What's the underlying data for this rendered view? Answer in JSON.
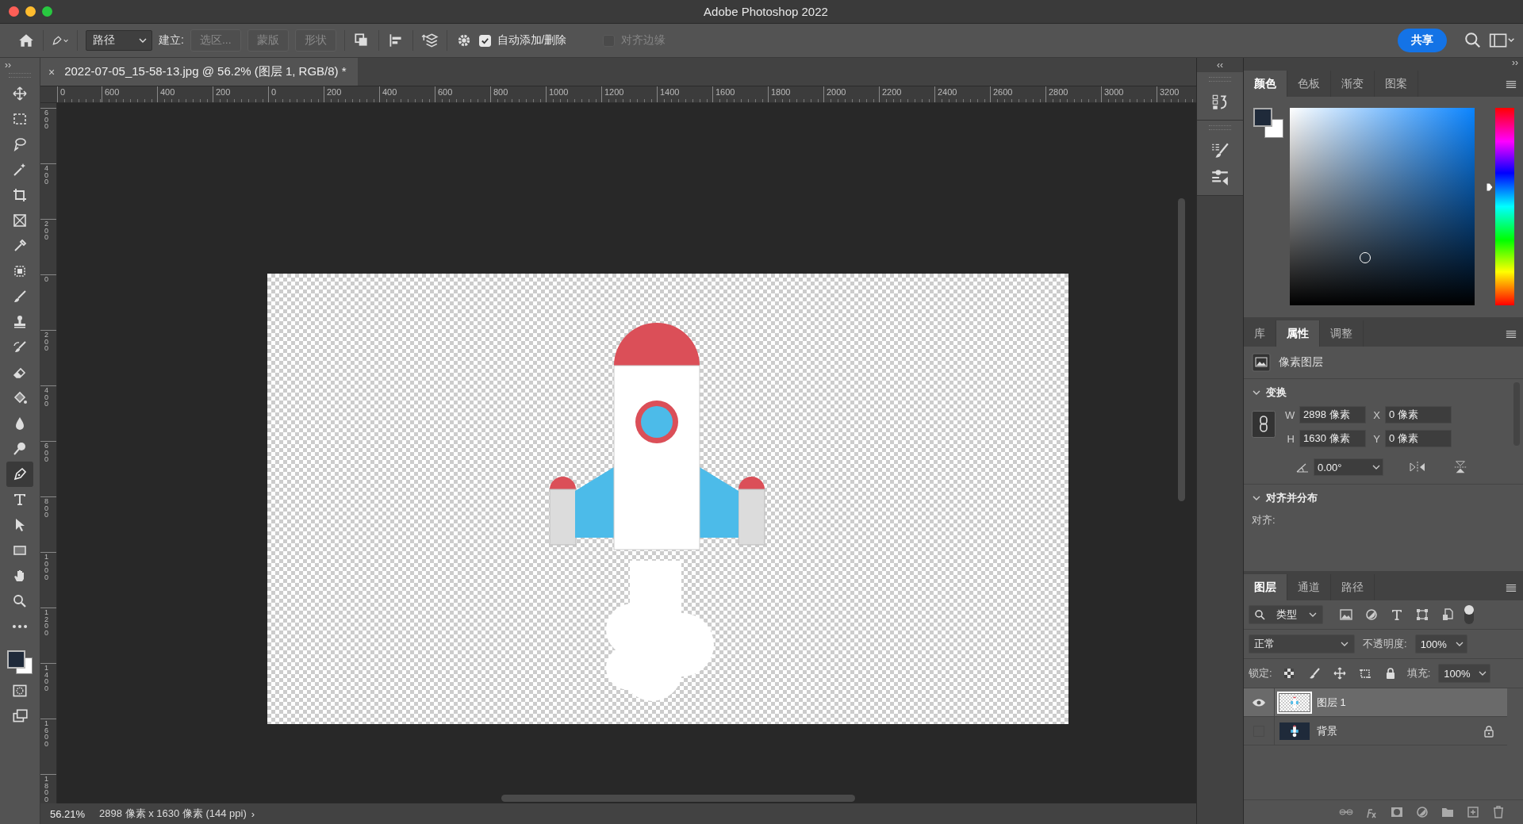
{
  "window": {
    "title": "Adobe Photoshop 2022"
  },
  "options_bar": {
    "mode": "路径",
    "make_label": "建立:",
    "make_buttons": [
      {
        "label": "选区...",
        "disabled": true
      },
      {
        "label": "蒙版",
        "disabled": true
      },
      {
        "label": "形状",
        "disabled": true
      }
    ],
    "auto_add_delete": {
      "label": "自动添加/删除",
      "checked": true
    },
    "align_edges": {
      "label": "对齐边缘",
      "checked": false,
      "disabled": true
    },
    "share_button": "共享"
  },
  "collapse_marks": {
    "toolbar": "››",
    "dock": "‹‹",
    "panels": "››"
  },
  "document_tab": {
    "close": "×",
    "title": "2022-07-05_15-58-13.jpg @ 56.2% (图层 1, RGB/8) *"
  },
  "ruler_h": [
    "0",
    "600",
    "400",
    "200",
    "0",
    "200",
    "400",
    "600",
    "800",
    "1000",
    "1200",
    "1400",
    "1600",
    "1800",
    "2000",
    "2200",
    "2400",
    "2600",
    "2800",
    "3000",
    "3200"
  ],
  "ruler_v": [
    "600",
    "400",
    "200",
    "0",
    "200",
    "400",
    "600",
    "800",
    "1000",
    "1200",
    "1400",
    "1600",
    "1800"
  ],
  "tools": [
    {
      "kind": "move",
      "selected": false
    },
    {
      "kind": "marquee",
      "selected": false
    },
    {
      "kind": "lasso",
      "selected": false
    },
    {
      "kind": "wand",
      "selected": false
    },
    {
      "kind": "crop",
      "selected": false
    },
    {
      "kind": "frame",
      "selected": false
    },
    {
      "kind": "eyedropper",
      "selected": false
    },
    {
      "kind": "patch",
      "selected": false
    },
    {
      "kind": "brush",
      "selected": false
    },
    {
      "kind": "stamp",
      "selected": false
    },
    {
      "kind": "history",
      "selected": false
    },
    {
      "kind": "eraser",
      "selected": false
    },
    {
      "kind": "bucket",
      "selected": false
    },
    {
      "kind": "blur",
      "selected": false
    },
    {
      "kind": "dodge",
      "selected": false
    },
    {
      "kind": "pen",
      "selected": true
    },
    {
      "kind": "type",
      "selected": false
    },
    {
      "kind": "arrow",
      "selected": false
    },
    {
      "kind": "rect",
      "selected": false
    },
    {
      "kind": "hand",
      "selected": false
    },
    {
      "kind": "zoom",
      "selected": false
    },
    {
      "kind": "more",
      "selected": false
    }
  ],
  "color_panel": {
    "hue_slider": {
      "level": 0.6
    },
    "tabs": [
      {
        "label": "颜色",
        "selected": true
      },
      {
        "label": "色板",
        "selected": false
      },
      {
        "label": "渐变",
        "selected": false
      },
      {
        "label": "图案",
        "selected": false
      }
    ]
  },
  "properties_panel": {
    "tabs": [
      {
        "label": "库",
        "selected": false
      },
      {
        "label": "属性",
        "selected": true
      },
      {
        "label": "调整",
        "selected": false
      }
    ],
    "layer_kind": "像素图层",
    "transform": {
      "title": "变换",
      "expanded": true,
      "w_label": "W",
      "w": "2898 像素",
      "x_label": "X",
      "x": "0 像素",
      "h_label": "H",
      "h": "1630 像素",
      "y_label": "Y",
      "y": "0 像素",
      "angle": "0.00°"
    },
    "align": {
      "title": "对齐并分布",
      "expanded": true,
      "label": "对齐:"
    }
  },
  "layers_panel": {
    "tabs": [
      {
        "label": "图层",
        "selected": true
      },
      {
        "label": "通道",
        "selected": false
      },
      {
        "label": "路径",
        "selected": false
      }
    ],
    "filter": "类型",
    "blend_mode": "正常",
    "opacity_label": "不透明度:",
    "opacity": "100%",
    "lock_label": "锁定:",
    "fill_label": "填充:",
    "fill": "100%",
    "layers": [
      {
        "name": "图层 1",
        "kind": "transparent",
        "visible": true,
        "selected": true,
        "locked": false
      },
      {
        "name": "背景",
        "kind": "dark",
        "visible": false,
        "selected": false,
        "locked": true
      }
    ]
  },
  "status_bar": {
    "zoom": "56.21%",
    "info": "2898 像素 x 1630 像素 (144 ppi)",
    "arrow": "›"
  }
}
